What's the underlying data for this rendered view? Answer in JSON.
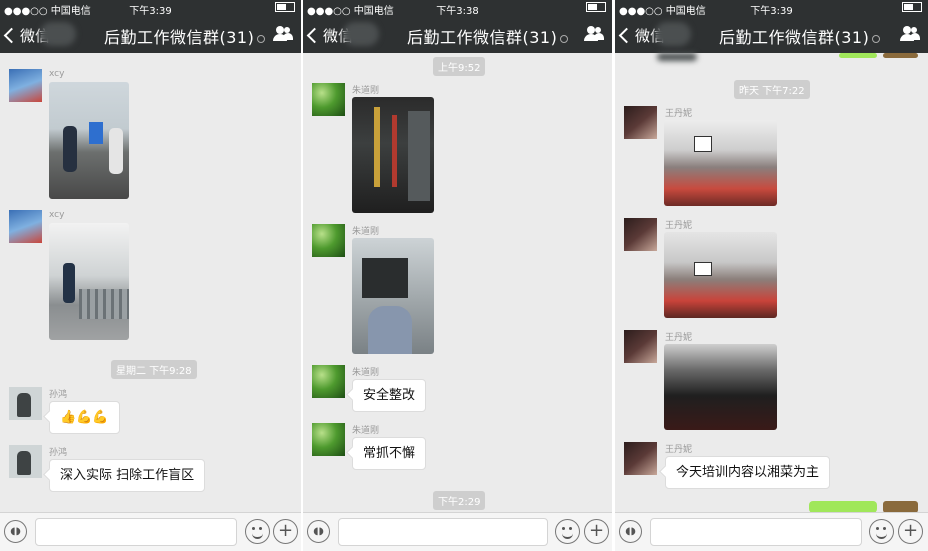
{
  "group_title": "后勤工作微信群(31)",
  "back_label": "微信",
  "carrier": "●●●○○ 中国电信",
  "panels": [
    {
      "time": "下午3:39",
      "messages": [
        {
          "sender": "xcy"
        },
        {
          "sender": "xcy"
        },
        {
          "timestamp": "星期二 下午9:28"
        },
        {
          "sender": "孙鸿",
          "text": "👍💪💪"
        },
        {
          "sender": "孙鸿",
          "text": "深入实际 扫除工作盲区"
        }
      ]
    },
    {
      "time": "下午3:38",
      "messages": [
        {
          "timestamp": "上午9:52"
        },
        {
          "sender": "朱道刚"
        },
        {
          "sender": "朱道刚"
        },
        {
          "sender": "朱道刚",
          "text": "安全整改"
        },
        {
          "sender": "朱道刚",
          "text": "常抓不懈"
        },
        {
          "timestamp": "下午2:29"
        }
      ]
    },
    {
      "time": "下午3:39",
      "messages": [
        {
          "timestamp": "昨天 下午7:22"
        },
        {
          "sender": "王丹妮"
        },
        {
          "sender": "王丹妮"
        },
        {
          "sender": "王丹妮"
        },
        {
          "sender": "王丹妮",
          "text": "今天培训内容以湘菜为主"
        }
      ]
    }
  ],
  "colors": {
    "nav": "#2e3132",
    "chat_bg": "#ebebeb",
    "own_bubble": "#a0e75a"
  },
  "icons": [
    "back-chevron-icon",
    "mute-icon",
    "group-members-icon",
    "voice-icon",
    "emoji-icon",
    "plus-icon"
  ]
}
